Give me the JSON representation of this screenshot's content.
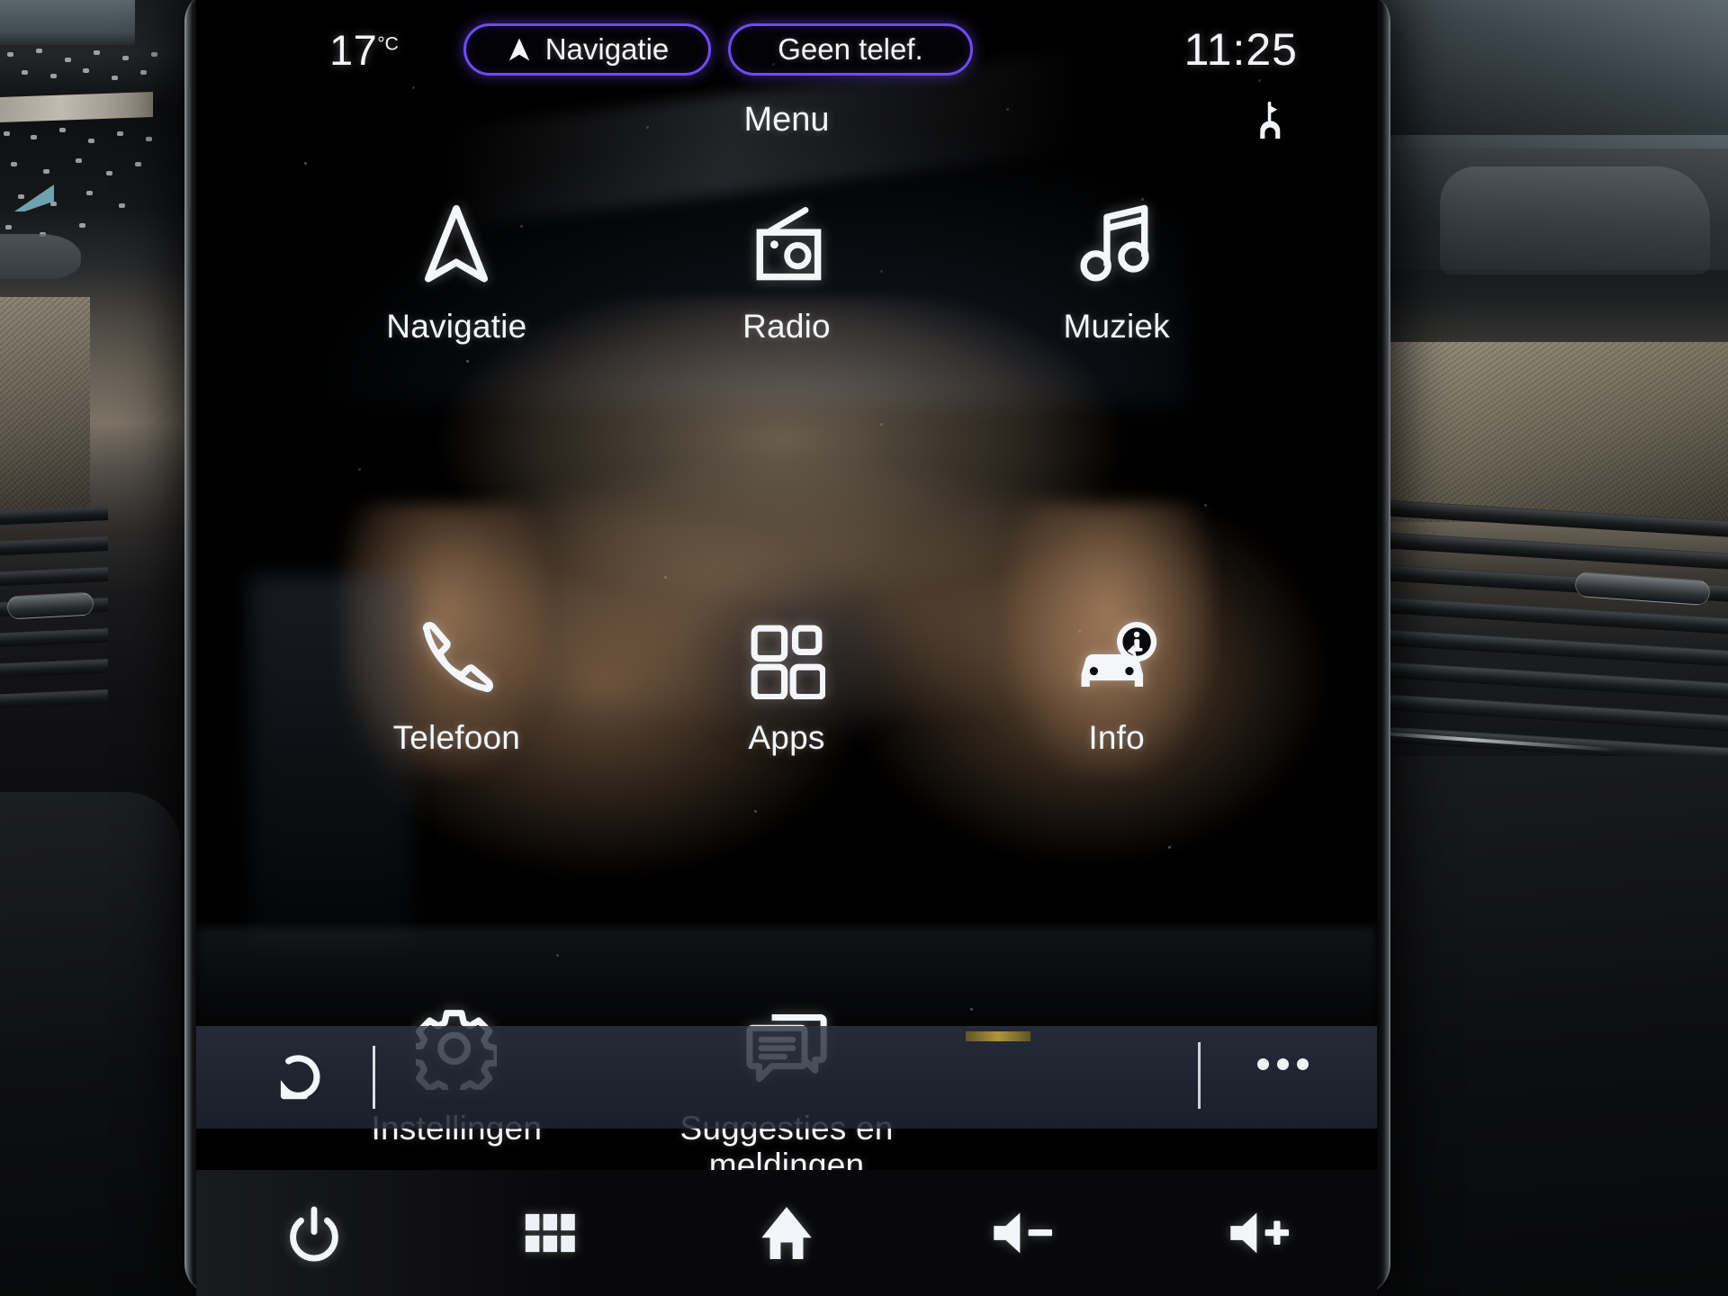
{
  "status_bar": {
    "temperature": "17",
    "temperature_unit": "°C",
    "nav_pill": {
      "label": "Navigatie",
      "icon": "navigation-arrow-icon"
    },
    "phone_pill": {
      "label": "Geen telef."
    },
    "clock": "11:25",
    "climate_icon": "seat-climate-icon",
    "accent_color": "#6d4df0"
  },
  "page": {
    "title": "Menu"
  },
  "menu": {
    "items": [
      {
        "label": "Navigatie",
        "icon": "navigation-arrow-icon"
      },
      {
        "label": "Radio",
        "icon": "radio-icon"
      },
      {
        "label": "Muziek",
        "icon": "music-note-icon"
      },
      {
        "label": "Telefoon",
        "icon": "phone-handset-icon"
      },
      {
        "label": "Apps",
        "icon": "apps-grid-icon"
      },
      {
        "label": "Info",
        "icon": "car-info-icon"
      },
      {
        "label": "Instellingen",
        "icon": "gear-icon"
      },
      {
        "label": "Suggesties en meldingen",
        "icon": "speech-bubbles-icon"
      }
    ]
  },
  "toolbar": {
    "back_icon": "back-arrow-icon",
    "more_icon": "more-options-icon"
  },
  "hardware_bar": {
    "buttons": [
      {
        "icon": "power-icon"
      },
      {
        "icon": "app-grid-icon"
      },
      {
        "icon": "home-icon"
      },
      {
        "icon": "volume-down-icon"
      },
      {
        "icon": "volume-up-icon"
      }
    ]
  },
  "colors": {
    "accent": "#6d4df0",
    "screen_bg": "#000000",
    "text": "#f4f6f9",
    "toolbar_bg": "#2c3442"
  }
}
